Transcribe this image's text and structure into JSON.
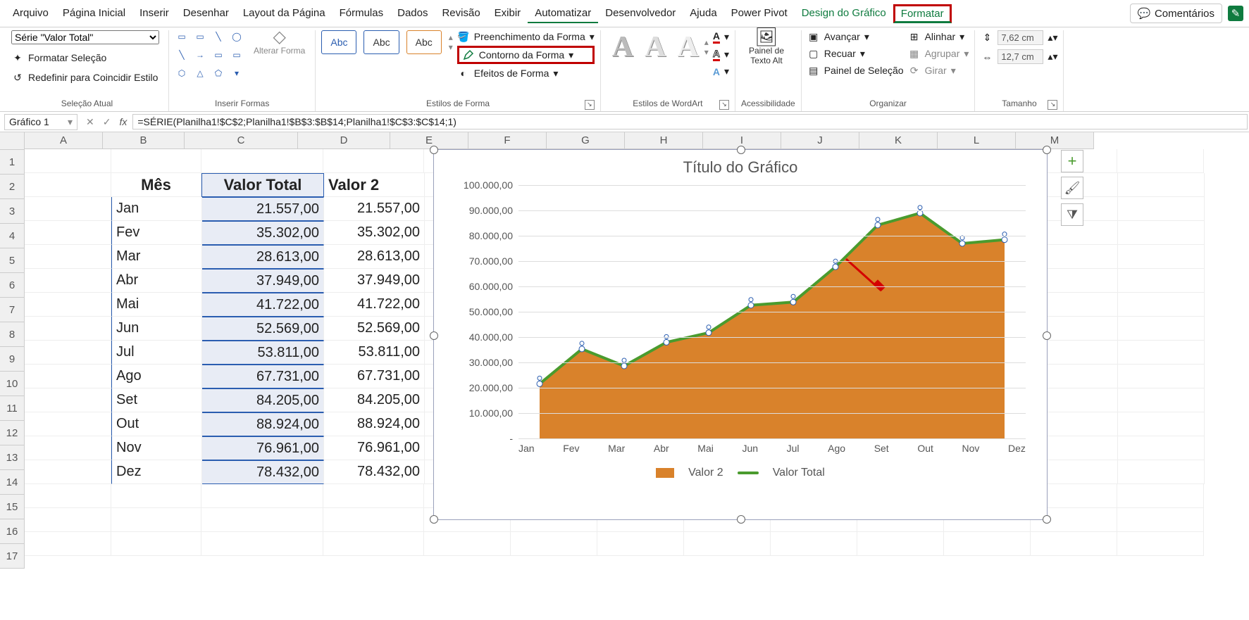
{
  "menu": [
    "Arquivo",
    "Página Inicial",
    "Inserir",
    "Desenhar",
    "Layout da Página",
    "Fórmulas",
    "Dados",
    "Revisão",
    "Exibir",
    "Automatizar",
    "Desenvolvedor",
    "Ajuda",
    "Power Pivot",
    "Design do Gráfico",
    "Formatar"
  ],
  "comments_label": "Comentários",
  "ribbon": {
    "sel": {
      "dropdown": "Série \"Valor Total\"",
      "format_sel": "Formatar Seleção",
      "reset": "Redefinir para Coincidir Estilo",
      "group": "Seleção Atual"
    },
    "shapes": {
      "alterar": "Alterar Forma",
      "group": "Inserir Formas"
    },
    "styles": {
      "abc": "Abc",
      "fill": "Preenchimento da Forma",
      "outline": "Contorno da Forma",
      "effects": "Efeitos de Forma",
      "group": "Estilos de Forma"
    },
    "wordart": {
      "group": "Estilos de WordArt"
    },
    "alt": {
      "btn": "Painel de Texto Alt",
      "group": "Acessibilidade"
    },
    "arrange": {
      "forward": "Avançar",
      "backward": "Recuar",
      "pane": "Painel de Seleção",
      "align": "Alinhar",
      "group_btn": "Agrupar",
      "rotate": "Girar",
      "group": "Organizar"
    },
    "size": {
      "h": "7,62 cm",
      "w": "12,7 cm",
      "group": "Tamanho"
    }
  },
  "namebox": "Gráfico 1",
  "formula": "=SÉRIE(Planilha1!$C$2;Planilha1!$B$3:$B$14;Planilha1!$C$3:$C$14;1)",
  "cols": [
    "A",
    "B",
    "C",
    "D",
    "E",
    "F",
    "G",
    "H",
    "I",
    "J",
    "K",
    "L",
    "M"
  ],
  "rows": [
    "1",
    "2",
    "3",
    "4",
    "5",
    "6",
    "7",
    "8",
    "9",
    "10",
    "11",
    "12",
    "13",
    "14",
    "15",
    "16",
    "17"
  ],
  "table": {
    "headers": {
      "b": "Mês",
      "c": "Valor Total",
      "d": "Valor 2"
    },
    "data": [
      {
        "mes": "Jan",
        "c": "21.557,00",
        "d": "21.557,00"
      },
      {
        "mes": "Fev",
        "c": "35.302,00",
        "d": "35.302,00"
      },
      {
        "mes": "Mar",
        "c": "28.613,00",
        "d": "28.613,00"
      },
      {
        "mes": "Abr",
        "c": "37.949,00",
        "d": "37.949,00"
      },
      {
        "mes": "Mai",
        "c": "41.722,00",
        "d": "41.722,00"
      },
      {
        "mes": "Jun",
        "c": "52.569,00",
        "d": "52.569,00"
      },
      {
        "mes": "Jul",
        "c": "53.811,00",
        "d": "53.811,00"
      },
      {
        "mes": "Ago",
        "c": "67.731,00",
        "d": "67.731,00"
      },
      {
        "mes": "Set",
        "c": "84.205,00",
        "d": "84.205,00"
      },
      {
        "mes": "Out",
        "c": "88.924,00",
        "d": "88.924,00"
      },
      {
        "mes": "Nov",
        "c": "76.961,00",
        "d": "76.961,00"
      },
      {
        "mes": "Dez",
        "c": "78.432,00",
        "d": "78.432,00"
      }
    ]
  },
  "chart_data": {
    "type": "area+line",
    "title": "Título do Gráfico",
    "categories": [
      "Jan",
      "Fev",
      "Mar",
      "Abr",
      "Mai",
      "Jun",
      "Jul",
      "Ago",
      "Set",
      "Out",
      "Nov",
      "Dez"
    ],
    "series": [
      {
        "name": "Valor 2",
        "type": "area",
        "color": "#d9822b",
        "values": [
          21557,
          35302,
          28613,
          37949,
          41722,
          52569,
          53811,
          67731,
          84205,
          88924,
          76961,
          78432
        ]
      },
      {
        "name": "Valor Total",
        "type": "line",
        "color": "#4a9b2e",
        "values": [
          21557,
          35302,
          28613,
          37949,
          41722,
          52569,
          53811,
          67731,
          84205,
          88924,
          76961,
          78432
        ]
      }
    ],
    "y_ticks": [
      "-",
      "10.000,00",
      "20.000,00",
      "30.000,00",
      "40.000,00",
      "50.000,00",
      "60.000,00",
      "70.000,00",
      "80.000,00",
      "90.000,00",
      "100.000,00"
    ],
    "ylim": [
      0,
      100000
    ]
  }
}
